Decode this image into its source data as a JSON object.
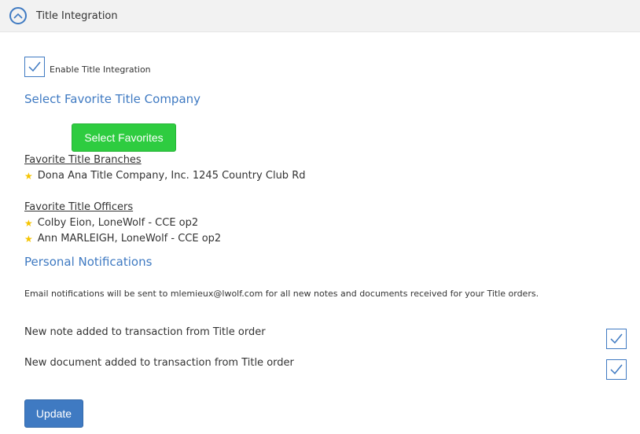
{
  "header": {
    "title": "Title Integration",
    "collapse_icon": "chevron-up-circle-icon"
  },
  "enable": {
    "label": "Enable Title Integration",
    "checked": true
  },
  "favorites": {
    "section_title": "Select Favorite Title Company",
    "select_button_label": "Select Favorites",
    "branches_heading": "Favorite Title Branches",
    "branches": [
      "Dona Ana Title Company, Inc. 1245 Country Club Rd"
    ],
    "officers_heading": "Favorite Title Officers",
    "officers": [
      "Colby Eion, LoneWolf - CCE op2",
      "Ann MARLEIGH, LoneWolf - CCE op2"
    ],
    "star_icon": "star-icon"
  },
  "notifications": {
    "section_title": "Personal Notifications",
    "info_text": "Email notifications will be sent to mlemieux@lwolf.com for all new notes and documents received for your Title orders.",
    "rows": [
      {
        "label": "New note added to transaction from Title order",
        "checked": true
      },
      {
        "label": "New document added to transaction from Title order",
        "checked": true
      }
    ]
  },
  "update_button_label": "Update",
  "colors": {
    "accent": "#3f7ac2",
    "green_button": "#2ecc40",
    "star": "#f5c400",
    "header_bg": "#f2f2f2"
  }
}
